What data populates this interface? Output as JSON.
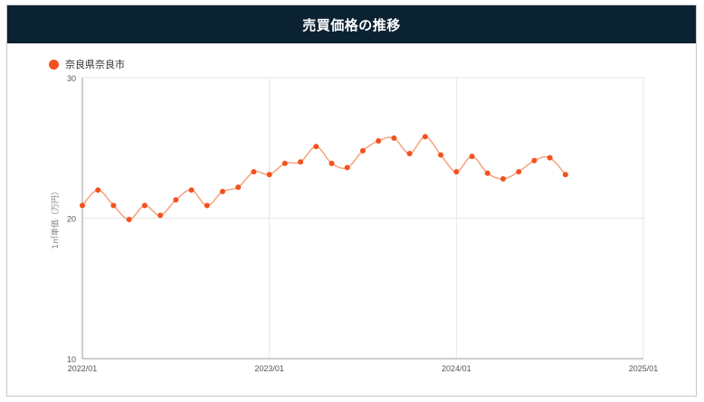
{
  "header": {
    "title": "売買価格の推移"
  },
  "colors": {
    "header_bg": "#0b2233",
    "series": "#f4511e",
    "line": "#f6a27f",
    "grid": "#e6e6e6"
  },
  "chart_data": {
    "type": "line",
    "title": "売買価格の推移",
    "xlabel": "",
    "ylabel": "1㎡単価（万円）",
    "ylim": [
      10,
      30
    ],
    "xlim": [
      "2022/01",
      "2025/01"
    ],
    "yticks": [
      10,
      20,
      30
    ],
    "xticks": [
      "2022/01",
      "2023/01",
      "2024/01",
      "2025/01"
    ],
    "grid": true,
    "legend_position": "top-left",
    "series": [
      {
        "name": "奈良県奈良市",
        "points": [
          {
            "x": "2022/01",
            "y": 20.9
          },
          {
            "x": "2022/02",
            "y": 22.0
          },
          {
            "x": "2022/03",
            "y": 20.9
          },
          {
            "x": "2022/04",
            "y": 19.9
          },
          {
            "x": "2022/05",
            "y": 20.9
          },
          {
            "x": "2022/06",
            "y": 20.2
          },
          {
            "x": "2022/07",
            "y": 21.3
          },
          {
            "x": "2022/08",
            "y": 22.0
          },
          {
            "x": "2022/09",
            "y": 20.9
          },
          {
            "x": "2022/10",
            "y": 21.9
          },
          {
            "x": "2022/11",
            "y": 22.2
          },
          {
            "x": "2022/12",
            "y": 23.3
          },
          {
            "x": "2023/01",
            "y": 23.1
          },
          {
            "x": "2023/02",
            "y": 23.9
          },
          {
            "x": "2023/03",
            "y": 24.0
          },
          {
            "x": "2023/04",
            "y": 25.1
          },
          {
            "x": "2023/05",
            "y": 23.9
          },
          {
            "x": "2023/06",
            "y": 23.6
          },
          {
            "x": "2023/07",
            "y": 24.8
          },
          {
            "x": "2023/08",
            "y": 25.5
          },
          {
            "x": "2023/09",
            "y": 25.7
          },
          {
            "x": "2023/10",
            "y": 24.6
          },
          {
            "x": "2023/11",
            "y": 25.8
          },
          {
            "x": "2023/12",
            "y": 24.5
          },
          {
            "x": "2024/01",
            "y": 23.3
          },
          {
            "x": "2024/02",
            "y": 24.4
          },
          {
            "x": "2024/03",
            "y": 23.2
          },
          {
            "x": "2024/04",
            "y": 22.8
          },
          {
            "x": "2024/05",
            "y": 23.3
          },
          {
            "x": "2024/06",
            "y": 24.1
          },
          {
            "x": "2024/07",
            "y": 24.3
          },
          {
            "x": "2024/08",
            "y": 23.1
          }
        ]
      }
    ]
  }
}
